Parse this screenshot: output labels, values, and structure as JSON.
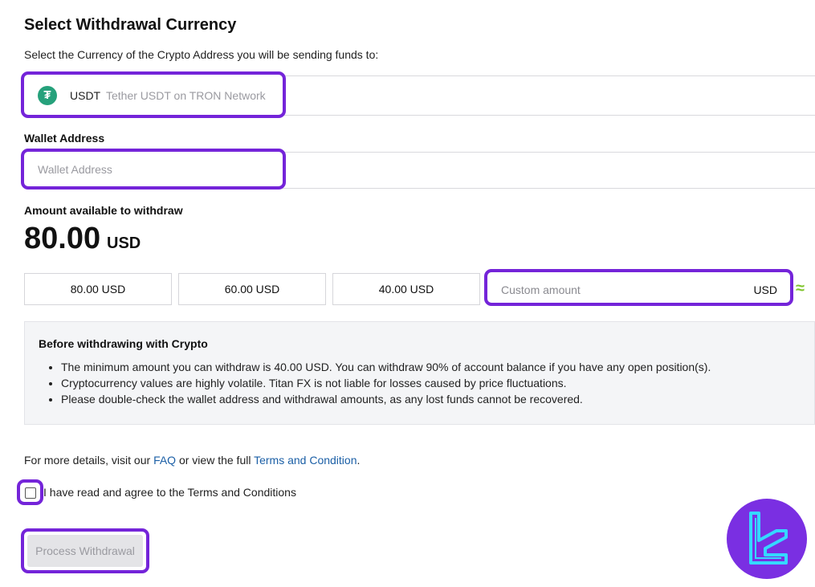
{
  "page": {
    "title": "Select Withdrawal Currency",
    "subtitle": "Select the Currency of the Crypto Address you will be sending funds to:"
  },
  "currency": {
    "icon": "tether-icon",
    "code": "USDT",
    "description": "Tether USDT on TRON Network",
    "icon_color": "#26a17b"
  },
  "wallet": {
    "label": "Wallet Address",
    "placeholder": "Wallet Address",
    "value": ""
  },
  "amount": {
    "label": "Amount available to withdraw",
    "value": "80.00",
    "currency": "USD",
    "quick_buttons": [
      "80.00 USD",
      "60.00 USD",
      "40.00 USD"
    ],
    "custom_placeholder": "Custom amount",
    "custom_currency": "USD",
    "approx_symbol": "≈"
  },
  "notice": {
    "title": "Before withdrawing with Crypto",
    "items": [
      "The minimum amount you can withdraw is 40.00 USD. You can withdraw 90% of account balance if you have any open position(s).",
      "Cryptocurrency values are highly volatile. Titan FX is not liable for losses caused by price fluctuations.",
      "Please double-check the wallet address and withdrawal amounts, as any lost funds cannot be recovered."
    ]
  },
  "details": {
    "prefix": "For more details, visit our ",
    "faq_link": "FAQ",
    "middle": " or view the full ",
    "terms_link": "Terms and Condition",
    "suffix": "."
  },
  "agreement": {
    "label": "I have read and agree to the Terms and Conditions",
    "checked": false
  },
  "submit": {
    "label": "Process Withdrawal"
  },
  "colors": {
    "highlight": "#7424d9",
    "link": "#1b5fa6",
    "logo_bg": "#7a2fe2",
    "logo_fg": "#35d8ff",
    "approx": "#7fc42b"
  }
}
